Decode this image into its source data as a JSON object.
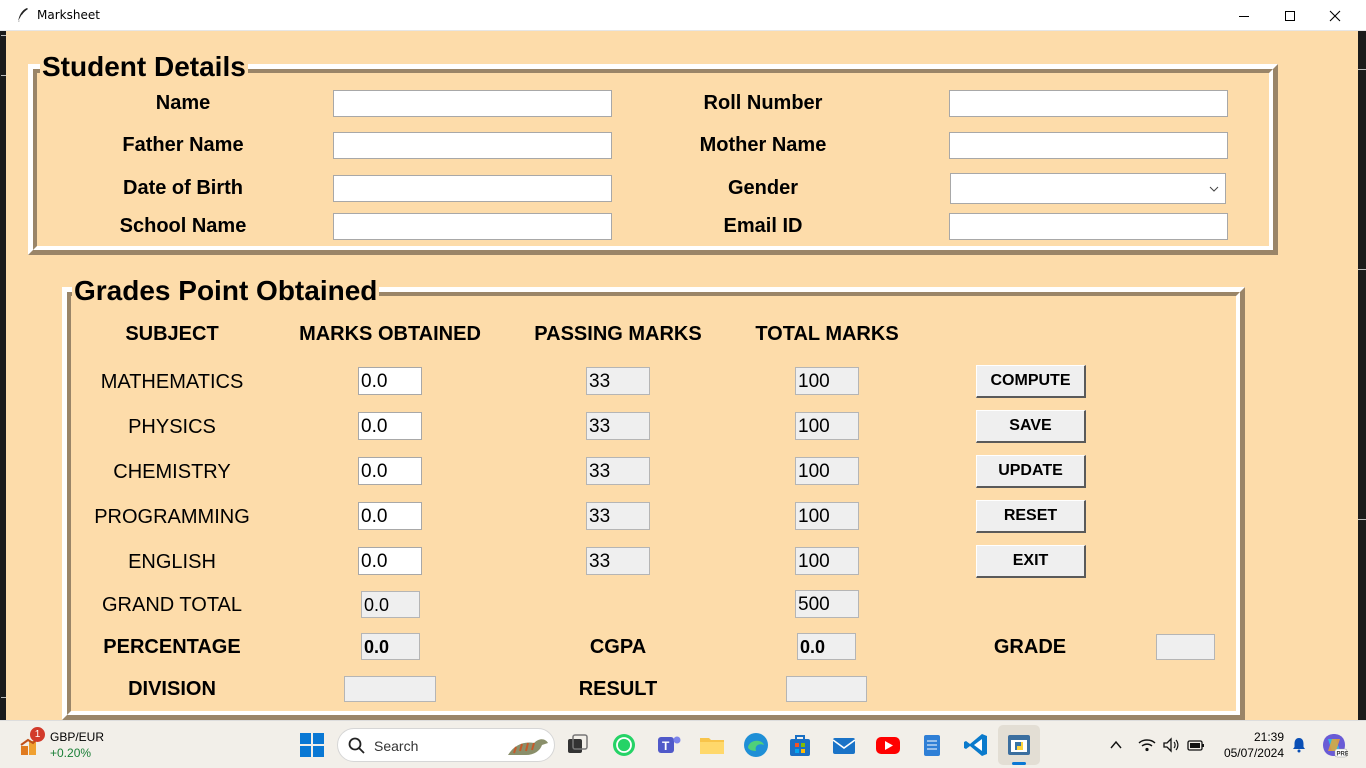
{
  "window": {
    "title": "Marksheet"
  },
  "student_details": {
    "heading": "Student Details",
    "name_label": "Name",
    "name_value": "",
    "roll_label": "Roll Number",
    "roll_value": "",
    "father_label": "Father Name",
    "father_value": "",
    "mother_label": "Mother Name",
    "mother_value": "",
    "dob_label": "Date of Birth",
    "dob_value": "",
    "gender_label": "Gender",
    "gender_value": "",
    "school_label": "School Name",
    "school_value": "",
    "email_label": "Email ID",
    "email_value": ""
  },
  "grades": {
    "heading": "Grades Point Obtained",
    "headers": {
      "subject": "SUBJECT",
      "marks": "MARKS OBTAINED",
      "passing": "PASSING MARKS",
      "total": "TOTAL MARKS"
    },
    "subjects": [
      {
        "name": "MATHEMATICS",
        "marks": "0.0",
        "passing": "33",
        "total": "100"
      },
      {
        "name": "PHYSICS",
        "marks": "0.0",
        "passing": "33",
        "total": "100"
      },
      {
        "name": "CHEMISTRY",
        "marks": "0.0",
        "passing": "33",
        "total": "100"
      },
      {
        "name": "PROGRAMMING",
        "marks": "0.0",
        "passing": "33",
        "total": "100"
      },
      {
        "name": "ENGLISH",
        "marks": "0.0",
        "passing": "33",
        "total": "100"
      }
    ],
    "grand_total_label": "GRAND TOTAL",
    "grand_total_obtained": "0.0",
    "grand_total_max": "500",
    "percentage_label": "PERCENTAGE",
    "percentage_value": "0.0",
    "cgpa_label": "CGPA",
    "cgpa_value": "0.0",
    "grade_label": "GRADE",
    "grade_value": "",
    "division_label": "DIVISION",
    "division_value": "",
    "result_label": "RESULT",
    "result_value": ""
  },
  "buttons": {
    "compute": "COMPUTE",
    "save": "SAVE",
    "update": "UPDATE",
    "reset": "RESET",
    "exit": "EXIT"
  },
  "taskbar": {
    "widget_badge": "1",
    "widget_title": "GBP/EUR",
    "widget_change": "+0.20%",
    "search_placeholder": "Search",
    "time": "21:39",
    "date": "05/07/2024"
  },
  "colors": {
    "window_bg": "#fddcaa",
    "frame_dark": "#9a8568",
    "frame_light": "#ffffff",
    "readonly_bg": "#efefef",
    "widget_change": "#1a7f37"
  },
  "icons": [
    "feather-icon",
    "minimize-icon",
    "maximize-icon",
    "close-icon",
    "windows-start-icon",
    "search-icon",
    "task-view-icon",
    "whatsapp-icon",
    "teams-icon",
    "file-explorer-icon",
    "edge-icon",
    "store-icon",
    "mail-icon",
    "youtube-icon",
    "notepad-icon",
    "vscode-icon",
    "python-idle-icon",
    "chevron-up-icon",
    "wifi-icon",
    "volume-icon",
    "battery-icon",
    "notification-bell-icon",
    "copilot-icon"
  ]
}
